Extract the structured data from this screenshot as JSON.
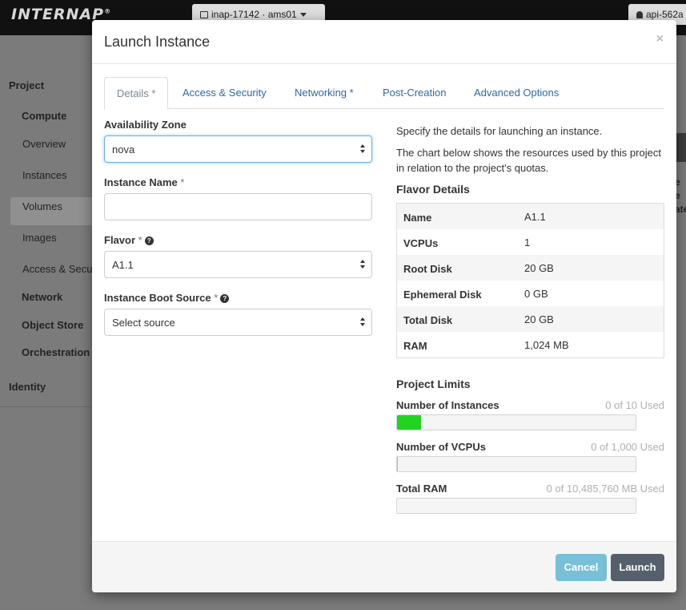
{
  "topbar": {
    "brand": "INTERNAP",
    "brand_tm": "®",
    "project_switcher": "inap-17142 · ams01",
    "user": "api-562a"
  },
  "sidebar": {
    "project": "Project",
    "compute": "Compute",
    "overview": "Overview",
    "instances": "Instances",
    "volumes": "Volumes",
    "images": "Images",
    "access_security": "Access & Secu",
    "network": "Network",
    "object_store": "Object Store",
    "orchestration": "Orchestration",
    "identity": "Identity"
  },
  "background_right": {
    "line1": "e",
    "line2": "e",
    "line3": "ate"
  },
  "modal": {
    "title": "Launch Instance",
    "close": "×",
    "tabs": [
      {
        "label": "Details",
        "required": "*",
        "active": true
      },
      {
        "label": "Access & Security",
        "required": ""
      },
      {
        "label": "Networking",
        "required": "*"
      },
      {
        "label": "Post-Creation",
        "required": ""
      },
      {
        "label": "Advanced Options",
        "required": ""
      }
    ],
    "form": {
      "availability_zone_label": "Availability Zone",
      "availability_zone_value": "nova",
      "instance_name_label": "Instance Name",
      "instance_name_value": "",
      "flavor_label": "Flavor",
      "flavor_value": "A1.1",
      "boot_source_label": "Instance Boot Source",
      "boot_source_value": "Select source",
      "required_mark": "*",
      "help_glyph": "?"
    },
    "info": {
      "line1": "Specify the details for launching an instance.",
      "line2": "The chart below shows the resources used by this project in relation to the project's quotas.",
      "flavor_details_title": "Flavor Details",
      "flavor_details": [
        {
          "name": "Name",
          "value": "A1.1"
        },
        {
          "name": "VCPUs",
          "value": "1"
        },
        {
          "name": "Root Disk",
          "value": "20 GB"
        },
        {
          "name": "Ephemeral Disk",
          "value": "0 GB"
        },
        {
          "name": "Total Disk",
          "value": "20 GB"
        },
        {
          "name": "RAM",
          "value": "1,024 MB"
        }
      ],
      "project_limits_title": "Project Limits",
      "limits": [
        {
          "name": "Number of Instances",
          "used_text": "0 of 10 Used",
          "fill_fraction": 0.1,
          "fill_color": "#22d322"
        },
        {
          "name": "Number of VCPUs",
          "used_text": "0 of 1,000 Used",
          "fill_fraction": 0.001,
          "fill_color": "#22d322"
        },
        {
          "name": "Total RAM",
          "used_text": "0 of 10,485,760 MB Used",
          "fill_fraction": 0.0,
          "fill_color": "#22d322"
        }
      ]
    },
    "footer": {
      "cancel": "Cancel",
      "launch": "Launch"
    }
  }
}
